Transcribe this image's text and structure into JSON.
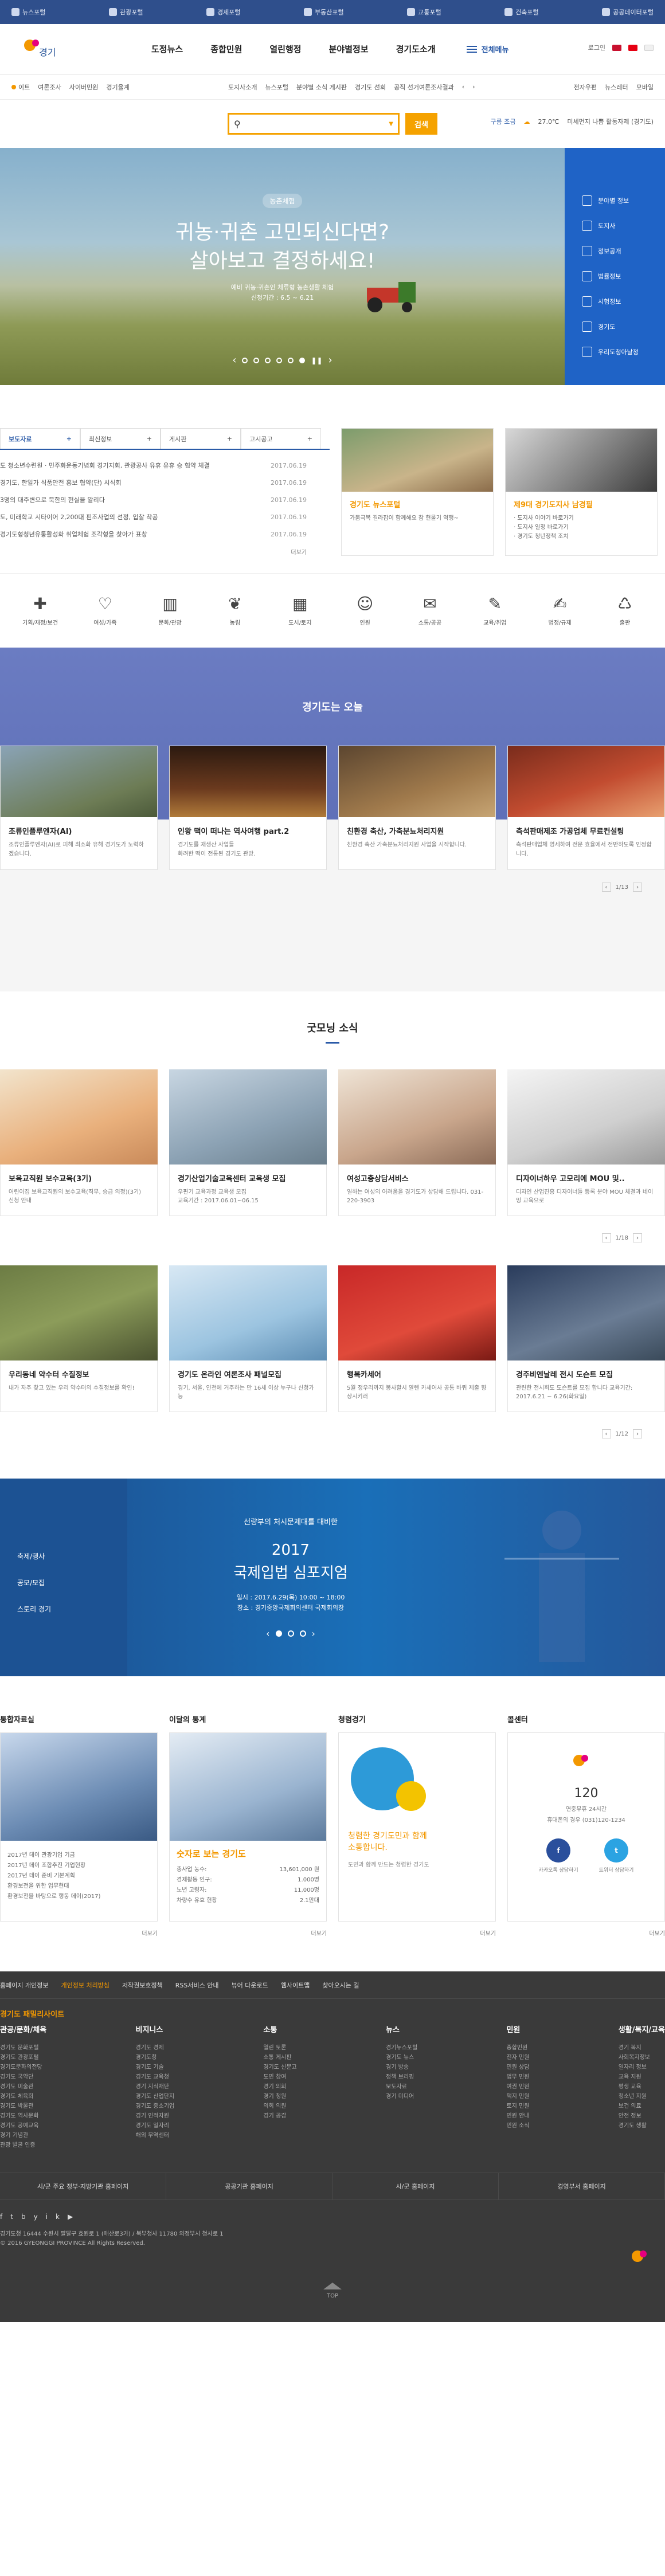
{
  "topbar": {
    "items": [
      "뉴스포털",
      "관광포털",
      "경제포털",
      "부동산포털",
      "교통포털",
      "건축포털",
      "공공데이터포털"
    ]
  },
  "header": {
    "menus": [
      "도정뉴스",
      "종합민원",
      "열린행정",
      "분야별정보",
      "경기도소개"
    ],
    "allmenu": "전체메뉴",
    "login": "로그인"
  },
  "subbar": {
    "left": [
      "이트",
      "여론조사",
      "사이버민원",
      "경기율계"
    ],
    "center": [
      "도지사소개",
      "뉴스포털",
      "분야별 소식 게시판",
      "경기도 선회",
      "공직 선거여론조사결과"
    ],
    "right": [
      "전자우편",
      "뉴스레터",
      "모바일"
    ]
  },
  "search": {
    "placeholder": "",
    "button": "검색",
    "weather_label": "구름 조금",
    "temp": "27.0℃",
    "notice": "미세먼지 나쁨 활동자제 (경기도)"
  },
  "hero": {
    "tag": "농촌체험",
    "line1": "귀농·귀촌 고민되신다면?",
    "line2": "살아보고 결정하세요!",
    "desc1": "예비 귀농·귀촌인 체류형 농촌생활 체험",
    "desc2": "신청기간 : 6.5 ~ 6.21",
    "quick": [
      "분야별 정보",
      "도지사",
      "정보공개",
      "법률정보",
      "시험정보",
      "경기도",
      "우리도청아날정"
    ]
  },
  "news": {
    "tabs": [
      "보도자료",
      "최신정보",
      "게시판",
      "고시공고"
    ],
    "items": [
      {
        "t": "도 청소년수련원 · 민주화운동기념회 경기지회, 관광공사 유휴 유휴 승 협약 체결",
        "d": "2017.06.19"
      },
      {
        "t": "경기도, 한일가 식품안전 홍보 협약(단) 시식회",
        "d": "2017.06.19"
      },
      {
        "t": "3명의 대주변으로 북한의 현실을 알리다",
        "d": "2017.06.19"
      },
      {
        "t": "도, 미래학교 시타이어 2,200대 핀조사업의 선정, 입찰 착공",
        "d": "2017.06.19"
      },
      {
        "t": "경기도형청년유통활성화 취업체험 조각형을 찾아가 표창",
        "d": "2017.06.19"
      }
    ],
    "more": "더보기",
    "card1": {
      "t": "경기도 뉴스포털",
      "s": "가뭄극복 길라잡이 함께해요 참 현물기 역행~"
    },
    "card2": {
      "t": "제9대 경기도지사 남경필",
      "s": "· 도지사 이야기 바로가기\n· 도지사 일정 바로가기\n· 경기도 청년정책 조치"
    }
  },
  "icons": [
    "기획/재정/보건",
    "여성/가족",
    "문화/관광",
    "농림",
    "도시/토지",
    "인원",
    "소통/공공",
    "교육/취업",
    "법정/규제",
    "출판"
  ],
  "today": {
    "title": "경기도는 오늘",
    "cards": [
      {
        "t": "조류인플루엔자(AI)",
        "s": "조류인플루엔자(AI)로 피해 최소화 유해 경기도가 노력하겠습니다."
      },
      {
        "t": "인왕 떡이 떠나는 역사여행 part.2",
        "s": "경기도를 재생산 사업들\n화려한 떡이 전통된 경기도 관방."
      },
      {
        "t": "친환경 축산, 가축분뇨처리지원",
        "s": "친환경 축산 가축분뇨처리지원 사업을 시작합니다."
      },
      {
        "t": "측석판매제조 가공업체 무료컨설팅",
        "s": "측석판매업체 영세하여 전문 효율에서 전반하도록 인정합니다."
      }
    ],
    "pager": "1/13"
  },
  "goodmorning": {
    "title": "굿모닝 소식",
    "row1": [
      {
        "t": "보육교직원 보수교육(3기)",
        "s": "어린이집 보육교직원의 보수교육(직무, 승급 의정)(3기)\n신청 안내"
      },
      {
        "t": "경기산업기술교육센터 교육생 모집",
        "s": "우편기 교육과정 교육생 모집\n교육기간 : 2017.06.01~06.15"
      },
      {
        "t": "여성고충상담서비스",
        "s": "일하는 여성의 어려움을 경기도가 상담해 드립니다. 031-220-3903"
      },
      {
        "t": "디자이너하우 고모리에 MOU 및..",
        "s": "디자인 산업진흥 디자이너들 등록 분야 MOU 체결과 네이밍 교육으로"
      }
    ],
    "row2": [
      {
        "t": "우리동네 약수터 수질정보",
        "s": "내가 자주 찾고 있는 우리 약수터의 수질정보를 확인!"
      },
      {
        "t": "경기도 온라인 여론조사 패널모집",
        "s": "경기, 서울, 인천에 거주하는 만 16세 이상 누구나 신청가능"
      },
      {
        "t": "행복카세어",
        "s": "5월 정우리까지 봉사할시 알렌 카세어사 공통 바퀴 제출 향상시키러"
      },
      {
        "t": "경주비엔날레 전시 도슨트 모집",
        "s": "관련한 전시회도 도슨트를 모집 합니다 교육기간: 2017.6.21 ~ 6.26(화요일)"
      }
    ],
    "pager1": "1/18",
    "pager2": "1/12"
  },
  "symposium": {
    "side": [
      "축제/행사",
      "공모/모집",
      "스토리 경기"
    ],
    "s1": "선량부의 처시문제대를 대비한",
    "s2": "2017",
    "s3": "국제입법 심포지엄",
    "s4a": "일시 : 2017.6.29(목) 10:00 ~ 18:00",
    "s4b": "장소 : 경기중앙국제회의센터 국제회의장"
  },
  "bottom": {
    "c1": {
      "h": "통합자료실",
      "items": [
        "2017년 데이 관광기업 기금",
        "2017년 데이 조합추진 기업현황",
        "2017년 데이 준비 기본계획",
        "환경보전을 위한 업무현대",
        "환경보전을 바탕으로 행동 데이(2017)"
      ]
    },
    "c2": {
      "h": "이달의 통계",
      "big": "숫자로 보는 경기도",
      "rows": [
        [
          "총사업 농수:",
          "13,601,000 원"
        ],
        [
          "경제활동 인구:",
          "1.000명"
        ],
        [
          "노년 고령자:",
          "11,000명"
        ],
        [
          "차량수 유효 현황",
          "2.1만대"
        ]
      ]
    },
    "c3": {
      "h": "청렴경기",
      "big1": "청렴한 경기도민과 함께",
      "big2": "소통합니다.",
      "s": "도민과 함께 만드는 청렴한 경기도"
    },
    "c4": {
      "h": "콜센터",
      "num": "120",
      "s1": "연중무휴 24시간",
      "s2": "휴대폰의 경우 (031)120-1234",
      "b1": "카카오톡 상담하기",
      "b2": "트위터 상담하기"
    },
    "more": "더보기"
  },
  "footer": {
    "links": [
      "홈페이지 개인정보",
      "개인정보 처리방침",
      "저작권보호정책",
      "RSS서비스 안내",
      "뷰어 다운로드",
      "웹사이트맵",
      "찾아오시는 길"
    ],
    "site": "경기도 패밀리사이트",
    "cols": [
      {
        "h": "관공/문화/체육",
        "items": [
          "경기도 문화포털",
          "경기도 관광포털",
          "경기도문화의전당",
          "경기도 국악단",
          "경기도 미술관",
          "경기도 체육회",
          "경기도 박물관",
          "경기도 역사문화",
          "경기도 공예교육",
          "경기 기념관",
          "관광 발굴 인증"
        ]
      },
      {
        "h": "비지니스",
        "items": [
          "경기도 경제",
          "경기도청",
          "경기도 기술",
          "경기도 교육청",
          "경기 지식재단",
          "경기도 산업단지",
          "경기도 중소기업",
          "경기 인적자원",
          "경기도 일자리",
          "해외 무역센터"
        ]
      },
      {
        "h": "소통",
        "items": [
          "열린 토론",
          "소통 게시판",
          "경기도 신문고",
          "도민 참여",
          "경기 의회",
          "경기 청원",
          "의회 의원",
          "경기 공감"
        ]
      },
      {
        "h": "뉴스",
        "items": [
          "경기뉴스포털",
          "경기도 뉴스",
          "경기 방송",
          "정책 브리핑",
          "보도자료",
          "경기 미디어"
        ]
      },
      {
        "h": "민원",
        "items": [
          "종합민원",
          "전자 민원",
          "민원 상담",
          "법무 민원",
          "여권 민원",
          "택지 민원",
          "토지 민원",
          "민원 안내",
          "민원 소식"
        ]
      },
      {
        "h": "생활/복지/교육",
        "items": [
          "경기 복지",
          "사회복지정보",
          "일자리 정보",
          "교육 지원",
          "평생 교육",
          "청소년 지원",
          "보건 의료",
          "안전 정보",
          "경기도 생활"
        ]
      }
    ],
    "btns": [
      "시/군 주요 정부·지방기관 홈페이지",
      "공공기관 홈페이지",
      "시/군 홈페이지",
      "경영부서 홈페이지"
    ],
    "social": [
      "f",
      "t",
      "b",
      "y",
      "i",
      "k",
      "▶"
    ],
    "addr1": "경기도청 16444 수원시 팔달구 효원로 1 (매산로3가) / 북부청사 11780 의정부시 청사로 1",
    "addr2": "© 2016 GYEONGGI PROVINCE All Rights Reserved.",
    "top": "TOP"
  },
  "colors": {
    "brand_blue": "#2a5aa7",
    "accent_orange": "#f39800",
    "search_orange": "#f5a200",
    "footer_bg": "#3a3a3a"
  }
}
